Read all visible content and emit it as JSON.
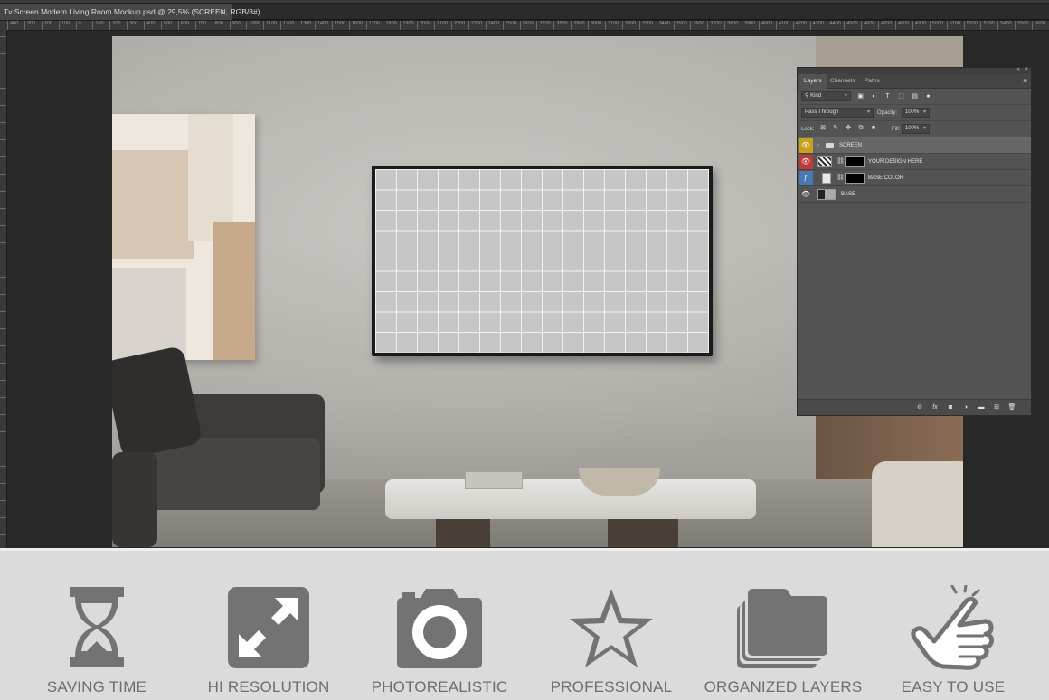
{
  "document": {
    "tab_title": "Tv Screen Modern Living Room Mockup.psd @ 29,5% (SCREEN, RGB/8#)",
    "close_glyph": "×"
  },
  "ruler": {
    "ticks": [
      "400",
      "300",
      "200",
      "100",
      "0",
      "100",
      "200",
      "300",
      "400",
      "500",
      "600",
      "700",
      "800",
      "900",
      "1000",
      "1100",
      "1200",
      "1300",
      "1400",
      "1500",
      "1600",
      "1700",
      "1800",
      "1900",
      "2000",
      "2100",
      "2200",
      "2300",
      "2400",
      "2500",
      "2600",
      "2700",
      "2800",
      "2900",
      "3000",
      "3100",
      "3200",
      "3300",
      "3400",
      "3500",
      "3600",
      "3700",
      "3800",
      "3900",
      "4000",
      "4100",
      "4200",
      "4300",
      "4400",
      "4500",
      "4600",
      "4700",
      "4800",
      "4900",
      "5000",
      "5100",
      "5200",
      "5300",
      "5400",
      "5500",
      "5600"
    ]
  },
  "layers_panel": {
    "tabs": [
      "Layers",
      "Channels",
      "Paths"
    ],
    "active_tab": "Layers",
    "filter_kind": "Kind",
    "blend_mode": "Pass Through",
    "opacity_label": "Opacity:",
    "opacity_value": "100%",
    "lock_label": "Lock:",
    "fill_label": "Fill:",
    "fill_value": "100%",
    "layers": [
      {
        "name": "SCREEN",
        "type": "group",
        "eye_color": "#c9a21b",
        "selected": true
      },
      {
        "name": "YOUR DESIGN HERE",
        "type": "smart-object",
        "eye_color": "#c0393b",
        "selected": false
      },
      {
        "name": "BASE COLOR",
        "type": "fill",
        "eye_color": "#4a78b5",
        "selected": false
      },
      {
        "name": "BASE",
        "type": "image",
        "eye_color": null,
        "selected": false
      }
    ]
  },
  "features": [
    {
      "label": "SAVING TIME",
      "icon": "hourglass-icon"
    },
    {
      "label": "HI RESOLUTION",
      "icon": "expand-icon"
    },
    {
      "label": "PHOTOREALISTIC",
      "icon": "camera-icon"
    },
    {
      "label": "PROFESSIONAL",
      "icon": "star-icon"
    },
    {
      "label": "ORGANIZED LAYERS",
      "icon": "layers-stack-icon"
    },
    {
      "label": "EASY TO USE",
      "icon": "hand-pointer-icon"
    }
  ],
  "colors": {
    "icon_gray": "#737373",
    "feature_bg": "#dbdbdb"
  }
}
